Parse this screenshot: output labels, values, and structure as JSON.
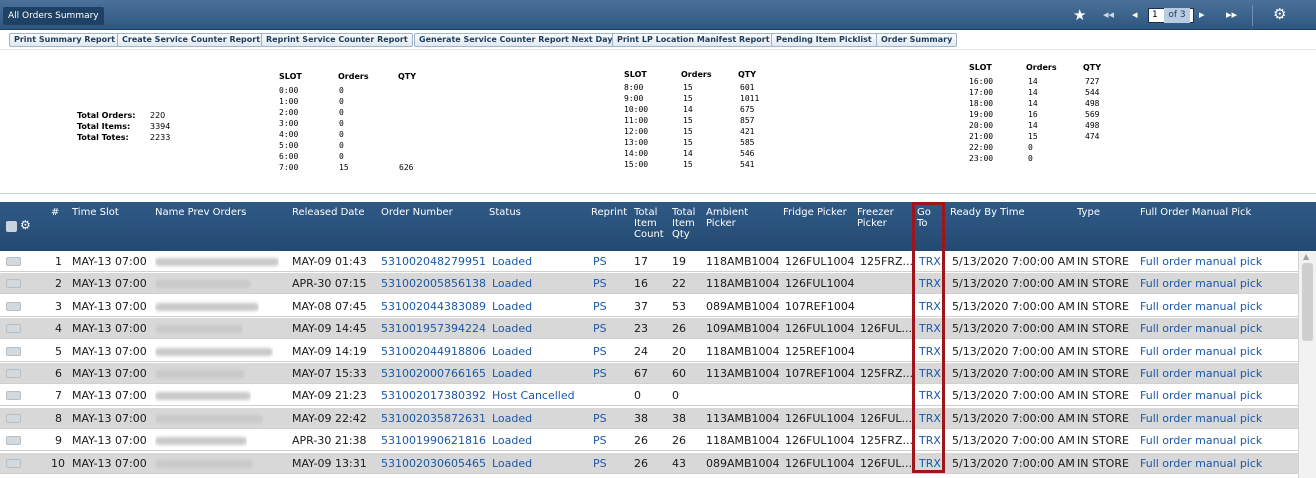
{
  "title": "All Orders Summary",
  "pager": {
    "star_icon": "star-icon",
    "current_page": "1",
    "of_label": "of 3"
  },
  "toolbar": [
    "Print Summary Report",
    "Create Service Counter Report",
    "Reprint Service Counter Report",
    "Generate Service Counter Report Next Day",
    "Print LP Location Manifest Report",
    "Pending Item Picklist",
    "Order Summary"
  ],
  "totals": {
    "orders_label": "Total Orders:",
    "orders": "220",
    "items_label": "Total Items:",
    "items": "3394",
    "totes_label": "Total Totes:",
    "totes": "2233"
  },
  "slot_headers": {
    "slot": "SLOT",
    "orders": "Orders",
    "qty": "QTY"
  },
  "slots_a": [
    [
      "0:00",
      "0",
      ""
    ],
    [
      "1:00",
      "0",
      ""
    ],
    [
      "2:00",
      "0",
      ""
    ],
    [
      "3:00",
      "0",
      ""
    ],
    [
      "4:00",
      "0",
      ""
    ],
    [
      "5:00",
      "0",
      ""
    ],
    [
      "6:00",
      "0",
      ""
    ],
    [
      "7:00",
      "15",
      "626"
    ]
  ],
  "slots_b": [
    [
      "8:00",
      "15",
      "601"
    ],
    [
      "9:00",
      "15",
      "1011"
    ],
    [
      "10:00",
      "14",
      "675"
    ],
    [
      "11:00",
      "15",
      "857"
    ],
    [
      "12:00",
      "15",
      "421"
    ],
    [
      "13:00",
      "15",
      "585"
    ],
    [
      "14:00",
      "14",
      "546"
    ],
    [
      "15:00",
      "15",
      "541"
    ]
  ],
  "slots_c": [
    [
      "16:00",
      "14",
      "727"
    ],
    [
      "17:00",
      "14",
      "544"
    ],
    [
      "18:00",
      "14",
      "498"
    ],
    [
      "19:00",
      "16",
      "569"
    ],
    [
      "20:00",
      "14",
      "498"
    ],
    [
      "21:00",
      "15",
      "474"
    ],
    [
      "22:00",
      "0",
      ""
    ],
    [
      "23:00",
      "0",
      ""
    ]
  ],
  "columns": {
    "num": "#",
    "time_slot": "Time Slot",
    "name": "Name Prev Orders",
    "released": "Released Date",
    "order_number": "Order Number",
    "status": "Status",
    "reprint": "Reprint",
    "total_item_count": "Total Item Count",
    "total_item_qty": "Total Item Qty",
    "ambient": "Ambient Picker",
    "fridge": "Fridge Picker",
    "freezer": "Freezer Picker",
    "goto": "Go To",
    "ready_by": "Ready By Time",
    "type": "Type",
    "manual_pick": "Full Order Manual Pick"
  },
  "rows": [
    {
      "n": "1",
      "slot": "MAY-13 07:00",
      "released": "MAY-09 01:43",
      "order": "531002048279951",
      "status": "Loaded",
      "reprint": "PS",
      "count": "17",
      "qty": "19",
      "ambient": "118AMB1004",
      "fridge": "126FUL1004",
      "freezer": "125FRZ...",
      "goto": "TRX",
      "ready": "5/13/2020 7:00:00 AM",
      "type": "IN STORE",
      "pick": "Full order manual pick"
    },
    {
      "n": "2",
      "slot": "MAY-13 07:00",
      "released": "APR-30 07:15",
      "order": "531002005856138",
      "status": "Loaded",
      "reprint": "PS",
      "count": "16",
      "qty": "22",
      "ambient": "118AMB1004",
      "fridge": "126FUL1004",
      "freezer": "",
      "goto": "TRX",
      "ready": "5/13/2020 7:00:00 AM",
      "type": "IN STORE",
      "pick": "Full order manual pick"
    },
    {
      "n": "3",
      "slot": "MAY-13 07:00",
      "released": "MAY-08 07:45",
      "order": "531002044383089",
      "status": "Loaded",
      "reprint": "PS",
      "count": "37",
      "qty": "53",
      "ambient": "089AMB1004",
      "fridge": "107REF1004",
      "freezer": "",
      "goto": "TRX",
      "ready": "5/13/2020 7:00:00 AM",
      "type": "IN STORE",
      "pick": "Full order manual pick"
    },
    {
      "n": "4",
      "slot": "MAY-13 07:00",
      "released": "MAY-09 14:45",
      "order": "531001957394224",
      "status": "Loaded",
      "reprint": "PS",
      "count": "23",
      "qty": "26",
      "ambient": "109AMB1004",
      "fridge": "126FUL1004",
      "freezer": "126FUL...",
      "goto": "TRX",
      "ready": "5/13/2020 7:00:00 AM",
      "type": "IN STORE",
      "pick": "Full order manual pick"
    },
    {
      "n": "5",
      "slot": "MAY-13 07:00",
      "released": "MAY-09 14:19",
      "order": "531002044918806",
      "status": "Loaded",
      "reprint": "PS",
      "count": "24",
      "qty": "20",
      "ambient": "118AMB1004",
      "fridge": "125REF1004",
      "freezer": "",
      "goto": "TRX",
      "ready": "5/13/2020 7:00:00 AM",
      "type": "IN STORE",
      "pick": "Full order manual pick"
    },
    {
      "n": "6",
      "slot": "MAY-13 07:00",
      "released": "MAY-07 15:33",
      "order": "531002000766165",
      "status": "Loaded",
      "reprint": "PS",
      "count": "67",
      "qty": "60",
      "ambient": "113AMB1004",
      "fridge": "107REF1004",
      "freezer": "125FRZ...",
      "goto": "TRX",
      "ready": "5/13/2020 7:00:00 AM",
      "type": "IN STORE",
      "pick": "Full order manual pick"
    },
    {
      "n": "7",
      "slot": "MAY-13 07:00",
      "released": "MAY-09 21:23",
      "order": "531002017380392",
      "status": "Host Cancelled",
      "reprint": "",
      "count": "0",
      "qty": "0",
      "ambient": "",
      "fridge": "",
      "freezer": "",
      "goto": "TRX",
      "ready": "5/13/2020 7:00:00 AM",
      "type": "IN STORE",
      "pick": "Full order manual pick"
    },
    {
      "n": "8",
      "slot": "MAY-13 07:00",
      "released": "MAY-09 22:42",
      "order": "531002035872631",
      "status": "Loaded",
      "reprint": "PS",
      "count": "38",
      "qty": "38",
      "ambient": "113AMB1004",
      "fridge": "126FUL1004",
      "freezer": "126FUL...",
      "goto": "TRX",
      "ready": "5/13/2020 7:00:00 AM",
      "type": "IN STORE",
      "pick": "Full order manual pick"
    },
    {
      "n": "9",
      "slot": "MAY-13 07:00",
      "released": "APR-30 21:38",
      "order": "531001990621816",
      "status": "Loaded",
      "reprint": "PS",
      "count": "26",
      "qty": "26",
      "ambient": "118AMB1004",
      "fridge": "126FUL1004",
      "freezer": "125FRZ...",
      "goto": "TRX",
      "ready": "5/13/2020 7:00:00 AM",
      "type": "IN STORE",
      "pick": "Full order manual pick"
    },
    {
      "n": "10",
      "slot": "MAY-13 07:00",
      "released": "MAY-09 13:31",
      "order": "531002030605465",
      "status": "Loaded",
      "reprint": "PS",
      "count": "26",
      "qty": "43",
      "ambient": "089AMB1004",
      "fridge": "126FUL1004",
      "freezer": "126FUL...",
      "goto": "TRX",
      "ready": "5/13/2020 7:00:00 AM",
      "type": "IN STORE",
      "pick": "Full order manual pick"
    }
  ],
  "colors": {
    "header": "#2f5a86",
    "link": "#1c58a6",
    "highlight": "#a0141c",
    "odd_row": "#d8d8d8"
  }
}
